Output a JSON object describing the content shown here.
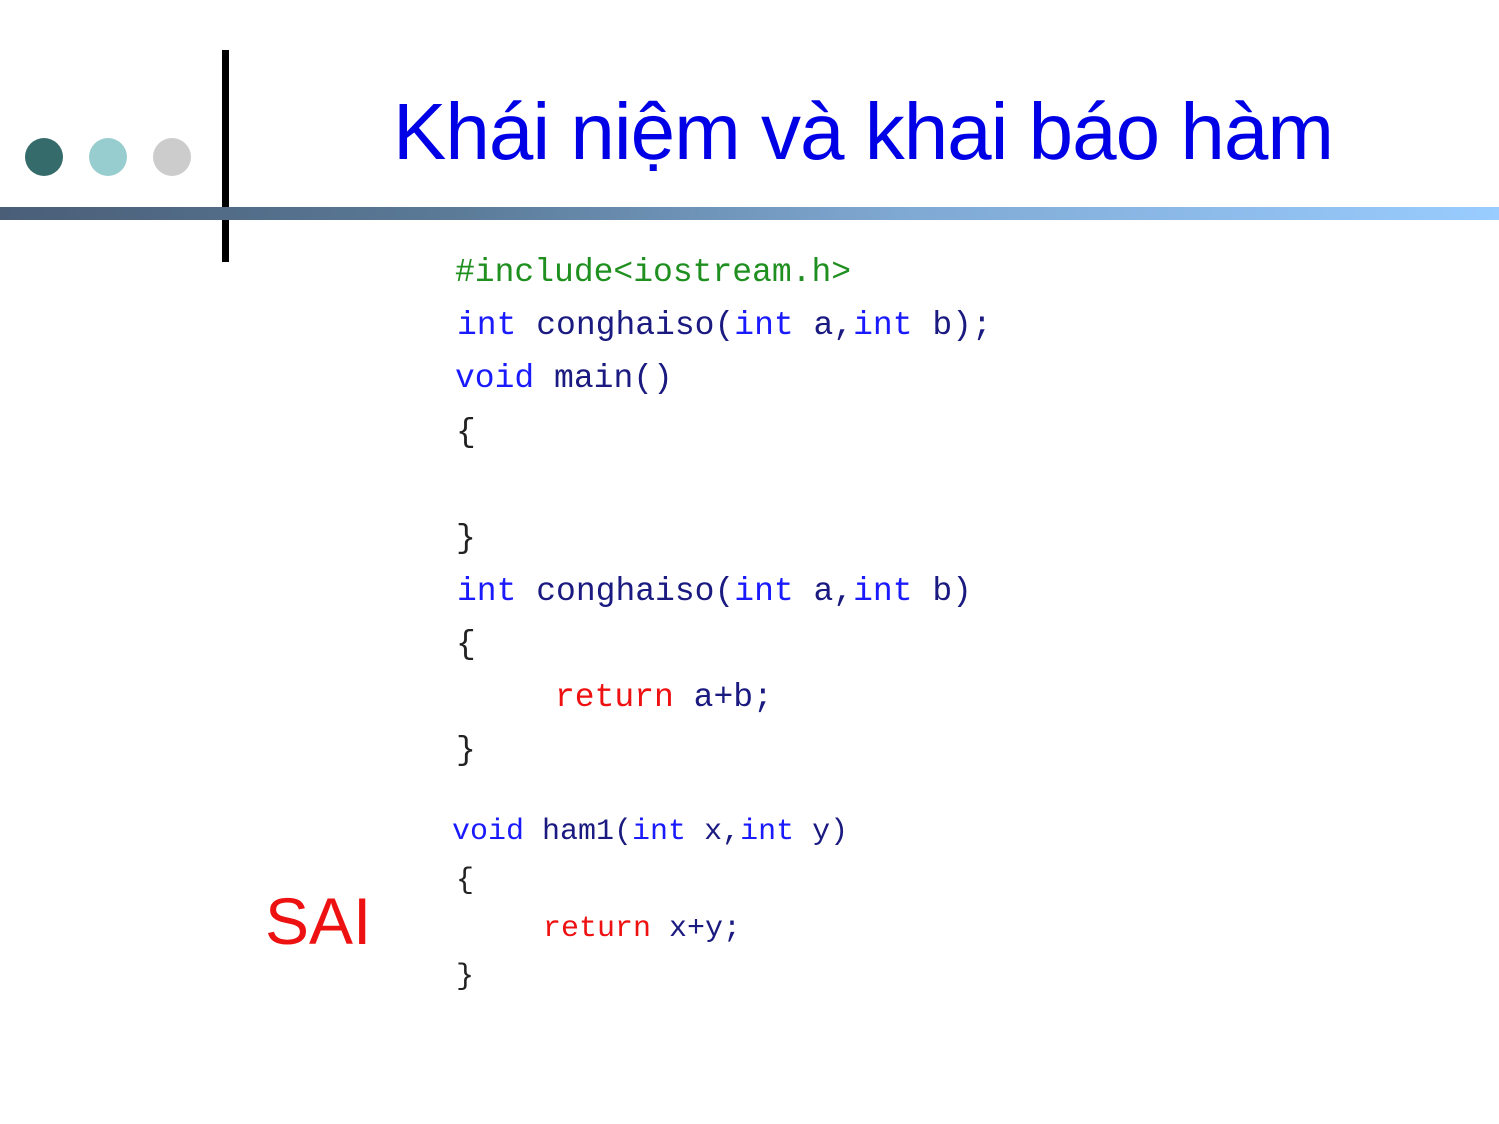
{
  "slide": {
    "title": "Khái niệm và khai báo hàm",
    "verdict_label": "SAI",
    "colors": {
      "title": "#0000e6",
      "verdict": "#ee1111",
      "dot1": "#356b6a",
      "dot2": "#98cdcf",
      "dot3": "#cccccc",
      "keyword": "#1a1aff",
      "identifier": "#1a1a80",
      "preprocessor": "#1f8f1f",
      "return_keyword": "#ee1111"
    }
  },
  "code": {
    "include": "#include<iostream.h>",
    "proto": {
      "kw1": "int",
      "name": "conghaiso(",
      "kw2": "int",
      "p1": "a,",
      "kw3": "int",
      "p2": "b);"
    },
    "main": {
      "kw": "void",
      "name": "main()"
    },
    "main_open": "{",
    "main_close": "}",
    "def": {
      "kw1": "int",
      "name": "conghaiso(",
      "kw2": "int",
      "p1": "a,",
      "kw3": "int",
      "p2": "b)"
    },
    "def_open": "{",
    "def_return": {
      "kw": "return",
      "expr": "a+b;"
    },
    "def_close": "}",
    "ham1": {
      "kw1": "void",
      "name": "ham1(",
      "kw2": "int",
      "p1": "x,",
      "kw3": "int",
      "p2": "y)"
    },
    "ham1_open": "{",
    "ham1_return": {
      "kw": "return",
      "expr": "x+y;"
    },
    "ham1_close": "}"
  }
}
